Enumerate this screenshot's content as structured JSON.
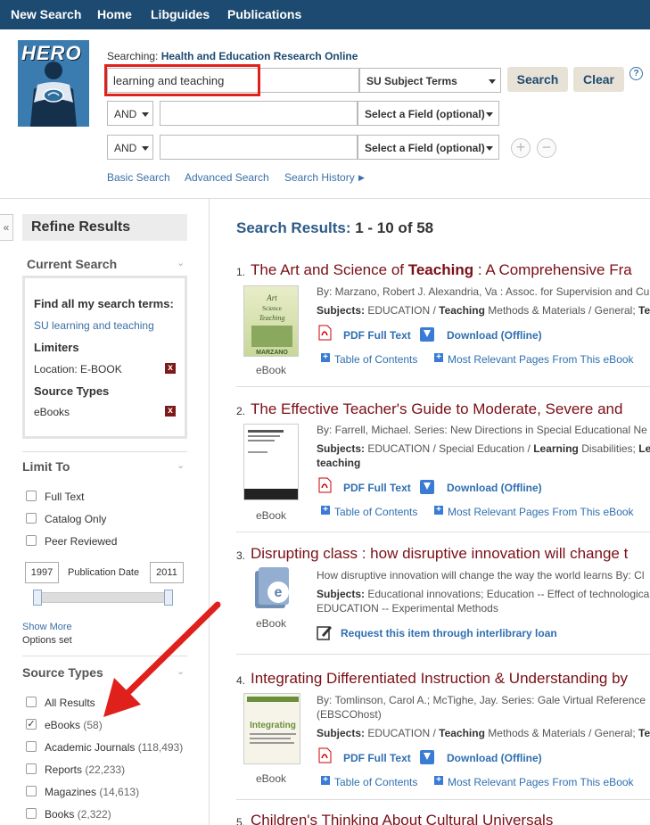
{
  "topnav": {
    "items": [
      "New Search",
      "Home",
      "Libguides",
      "Publications"
    ]
  },
  "logo": {
    "text": "HERO"
  },
  "search": {
    "searching_label": "Searching:",
    "database": "Health and Education Research Online",
    "query": "learning and teaching",
    "field1": "SU Subject Terms",
    "bool2": "AND",
    "field2": "Select a Field (optional)",
    "bool3": "AND",
    "field3": "Select a Field (optional)",
    "search_label": "Search",
    "clear_label": "Clear",
    "help_label": "?",
    "add_label": "+",
    "remove_label": "−",
    "basic": "Basic Search",
    "advanced": "Advanced Search",
    "history": "Search History"
  },
  "sidebar": {
    "collapse_label": "«",
    "refine_title": "Refine Results",
    "current_search_title": "Current Search",
    "find_all": "Find all my search terms:",
    "term": "SU learning and teaching",
    "limiters_title": "Limiters",
    "limiter": "Location: E-BOOK",
    "source_types_label": "Source Types",
    "source_type": "eBooks",
    "limit_to_title": "Limit To",
    "limit_options": [
      "Full Text",
      "Catalog Only",
      "Peer Reviewed"
    ],
    "date_from": "1997",
    "date_to": "2011",
    "date_label": "Publication Date",
    "date_range_fraction": [
      0.0,
      1.0
    ],
    "show_more": "Show More",
    "options_set": "Options set",
    "source_types_title": "Source Types",
    "source_options": [
      {
        "label": "All Results",
        "count": "",
        "checked": false
      },
      {
        "label": "eBooks",
        "count": "(58)",
        "checked": true
      },
      {
        "label": "Academic Journals",
        "count": "(118,493)",
        "checked": false
      },
      {
        "label": "Reports",
        "count": "(22,233)",
        "checked": false
      },
      {
        "label": "Magazines",
        "count": "(14,613)",
        "checked": false
      },
      {
        "label": "Books",
        "count": "(2,322)",
        "checked": false
      }
    ]
  },
  "results": {
    "head_label": "Search Results:",
    "head_range": "1 - 10 of 58",
    "items": [
      {
        "num": "1.",
        "title_a": "The Art and Science of ",
        "title_b": "Teaching",
        "title_c": " : A Comprehensive Fra",
        "byline": "By: Marzano, Robert J. Alexandria, Va : Assoc. for Supervision and Cu",
        "subjects_label": "Subjects:",
        "subjects_a": " EDUCATION / ",
        "subjects_b": "Teaching",
        "subjects_c": " Methods & Materials / General; ",
        "subjects_d": "Tea",
        "type": "eBook",
        "pdf": "PDF Full Text",
        "download": "Download (Offline)",
        "toc": "Table of Contents",
        "relevant": "Most Relevant Pages From This eBook"
      },
      {
        "num": "2.",
        "title_a": "The Effective Teacher's Guide to Moderate, Severe and",
        "byline": "By: Farrell, Michael. Series: New Directions in Special Educational Ne",
        "subjects_label": "Subjects:",
        "subjects_a": " EDUCATION / Special Education / ",
        "subjects_b": "Learning",
        "subjects_c": " Disabilities; ",
        "subjects_d": "Le",
        "subjects_line2": "teaching",
        "type": "eBook",
        "pdf": "PDF Full Text",
        "download": "Download (Offline)",
        "toc": "Table of Contents",
        "relevant": "Most Relevant Pages From This eBook"
      },
      {
        "num": "3.",
        "title_a": "Disrupting class : how disruptive innovation will change t",
        "byline": "How disruptive innovation will change the way the world learns By: Cl",
        "subjects_label": "Subjects:",
        "subjects_a": " Educational innovations; Education -- Effect of technologica",
        "subjects_line2": "EDUCATION -- Experimental Methods",
        "type": "eBook",
        "request": "Request this item through interlibrary loan"
      },
      {
        "num": "4.",
        "title_a": "Integrating Differentiated Instruction & Understanding by",
        "byline": "By: Tomlinson, Carol A.; McTighe, Jay. Series: Gale Virtual Reference",
        "byline2": "(EBSCOhost)",
        "subjects_label": "Subjects:",
        "subjects_a": " EDUCATION / ",
        "subjects_b": "Teaching",
        "subjects_c": " Methods & Materials / General; ",
        "subjects_d": "Tea",
        "type": "eBook",
        "pdf": "PDF Full Text",
        "download": "Download (Offline)",
        "toc": "Table of Contents",
        "relevant": "Most Relevant Pages From This eBook"
      },
      {
        "num": "5.",
        "title_a": "Children's Thinking About Cultural Universals"
      }
    ]
  },
  "colors": {
    "nav": "#1d4a70",
    "title": "#7a0f16",
    "link": "#2f6fb0",
    "highlight": "#e0201b"
  }
}
